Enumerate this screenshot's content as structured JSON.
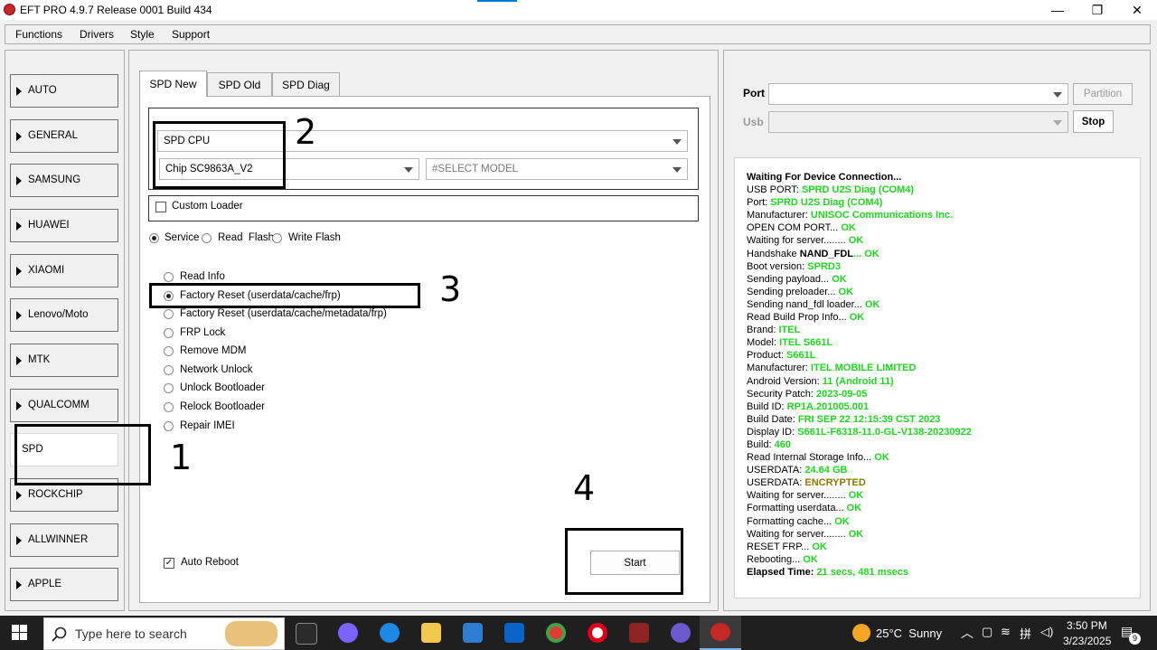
{
  "window": {
    "title": "EFT PRO 4.9.7 Release 0001 Build 434",
    "minimize": "—",
    "maximize": "❐",
    "close": "✕"
  },
  "menu": [
    "Functions",
    "Drivers",
    "Style",
    "Support"
  ],
  "sidebar": [
    {
      "label": "AUTO"
    },
    {
      "label": "GENERAL"
    },
    {
      "label": "SAMSUNG"
    },
    {
      "label": "HUAWEI"
    },
    {
      "label": "XIAOMI"
    },
    {
      "label": "Lenovo/Moto"
    },
    {
      "label": "MTK"
    },
    {
      "label": "QUALCOMM"
    },
    {
      "label": "SPD"
    },
    {
      "label": "ROCKCHIP"
    },
    {
      "label": "ALLWINNER"
    },
    {
      "label": "APPLE"
    }
  ],
  "tabs": [
    "SPD New",
    "SPD Old",
    "SPD Diag"
  ],
  "selectors": {
    "cpu": "SPD CPU",
    "chip": "Chip SC9863A_V2",
    "model": "#SELECT MODEL"
  },
  "custom_loader": "Custom Loader",
  "modes": [
    "Service",
    "Read  Flash",
    "Write Flash"
  ],
  "operations": [
    "Read Info",
    "Factory Reset (userdata/cache/frp)",
    "Factory Reset (userdata/cache/metadata/frp)",
    "FRP Lock",
    "Remove MDM",
    "Network Unlock",
    "Unlock Bootloader",
    "Relock Bootloader",
    "Repair IMEI"
  ],
  "auto_reboot": "Auto Reboot",
  "start": "Start",
  "annotations": [
    "1",
    "2",
    "3",
    "4"
  ],
  "port": {
    "label": "Port",
    "usb_label": "Usb",
    "partition": "Partition",
    "stop": "Stop"
  },
  "log": [
    {
      "k": "Waiting For Device Connection...",
      "v": "",
      "bold_k": true
    },
    {
      "k": "USB PORT: ",
      "v": "SPRD U2S Diag (COM4)"
    },
    {
      "k": "Port: ",
      "v": "SPRD U2S Diag (COM4)"
    },
    {
      "k": "Manufacturer: ",
      "v": "UNISOC Communications Inc."
    },
    {
      "k": "OPEN COM PORT... ",
      "v": "OK"
    },
    {
      "k": "Waiting for server........ ",
      "v": "OK"
    },
    {
      "k": "Handshake ",
      "k2": "NAND_FDL",
      "v": "... OK"
    },
    {
      "k": "Boot version: ",
      "v": "SPRD3"
    },
    {
      "k": "Sending payload... ",
      "v": "OK"
    },
    {
      "k": "Sending preloader... ",
      "v": "OK"
    },
    {
      "k": "Sending nand_fdl loader... ",
      "v": "OK"
    },
    {
      "k": "Read Build Prop Info... ",
      "v": "OK"
    },
    {
      "k": " Brand: ",
      "v": "ITEL"
    },
    {
      "k": " Model: ",
      "v": "ITEL S661L"
    },
    {
      "k": " Product: ",
      "v": "S661L"
    },
    {
      "k": " Manufacturer: ",
      "v": "ITEL MOBILE LIMITED"
    },
    {
      "k": " Android Version: ",
      "v": "11 (Android 11)"
    },
    {
      "k": " Security Patch: ",
      "v": "2023-09-05"
    },
    {
      "k": " Build ID: ",
      "v": "RP1A.201005.001"
    },
    {
      "k": " Build Date: ",
      "v": "FRI SEP 22 12:15:39 CST 2023"
    },
    {
      "k": " Display ID: ",
      "v": "S661L-F6318-11.0-GL-V138-20230922"
    },
    {
      "k": " Build: ",
      "v": "460"
    },
    {
      "k": "Read Internal Storage Info... ",
      "v": "OK"
    },
    {
      "k": "USERDATA: ",
      "v": "24.64 GB"
    },
    {
      "k": "USERDATA: ",
      "v": "ENCRYPTED",
      "olive": true
    },
    {
      "k": "Waiting for server........ ",
      "v": "OK"
    },
    {
      "k": "Formatting userdata... ",
      "v": "OK"
    },
    {
      "k": "Formatting cache... ",
      "v": "OK"
    },
    {
      "k": "Waiting for server........ ",
      "v": "OK"
    },
    {
      "k": "RESET FRP... ",
      "v": "OK"
    },
    {
      "k": "Rebooting... ",
      "v": "OK"
    },
    {
      "k": "Elapsed Time: ",
      "v": "21 secs, 481 msecs",
      "bold_k": true
    }
  ],
  "taskbar": {
    "search_placeholder": "Type here to search",
    "weather": "25°C  Sunny",
    "time": "3:50 PM",
    "date": "3/23/2025",
    "notifications": "9"
  }
}
